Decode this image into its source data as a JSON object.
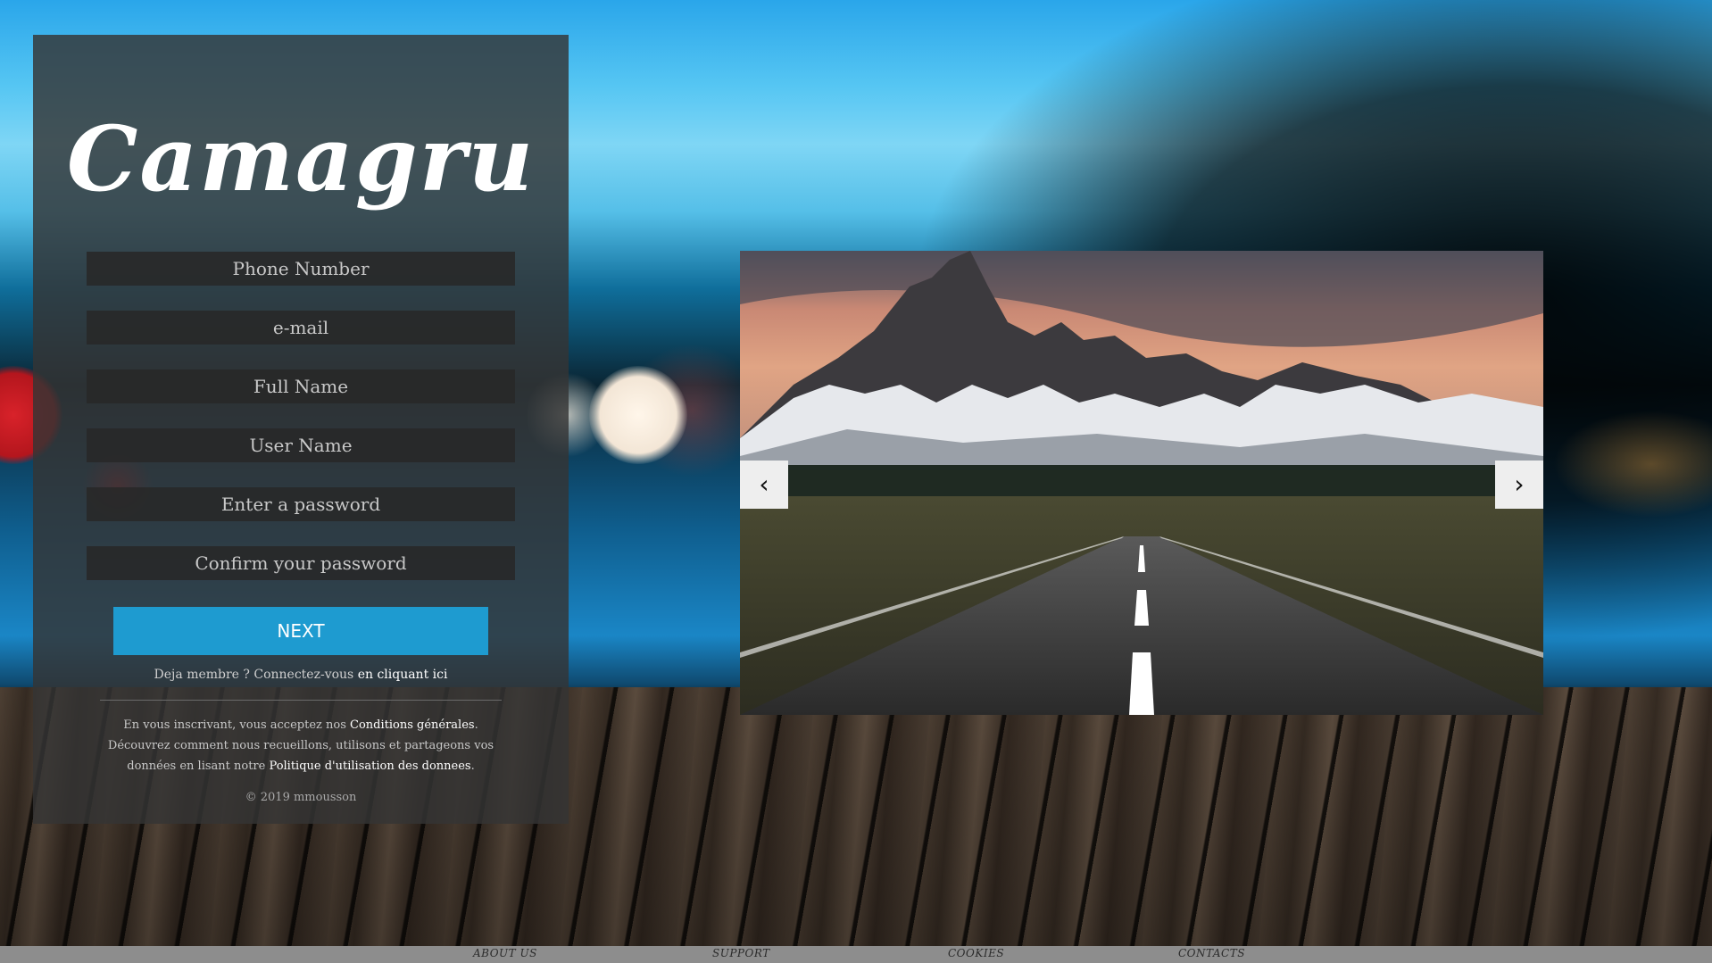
{
  "app": {
    "logo_text": "Camagru"
  },
  "signup": {
    "fields": {
      "phone_placeholder": "Phone Number",
      "email_placeholder": "e-mail",
      "fullname_placeholder": "Full Name",
      "username_placeholder": "User Name",
      "password_placeholder": "Enter a password",
      "confirm_placeholder": "Confirm your password"
    },
    "next_label": "NEXT",
    "member_text": "Deja membre ? Connectez-vous ",
    "member_link": "en cliquant ici",
    "terms": {
      "part1": "En vous inscrivant, vous acceptez nos ",
      "link1": "Conditions générales",
      "part2": ". Découvrez comment nous recueillons, utilisons et partageons vos données en lisant notre ",
      "link2": "Politique d'utilisation des donnees",
      "part3": "."
    },
    "copyright": "© 2019 mmousson"
  },
  "carousel": {
    "prev_label": "‹",
    "next_label": "›"
  },
  "footer": {
    "links": [
      "ABOUT US",
      "SUPPORT",
      "COOKIES",
      "CONTACTS"
    ]
  },
  "colors": {
    "accent": "#1e9bd0",
    "panel": "#343434",
    "footer": "#8d8d8d"
  }
}
